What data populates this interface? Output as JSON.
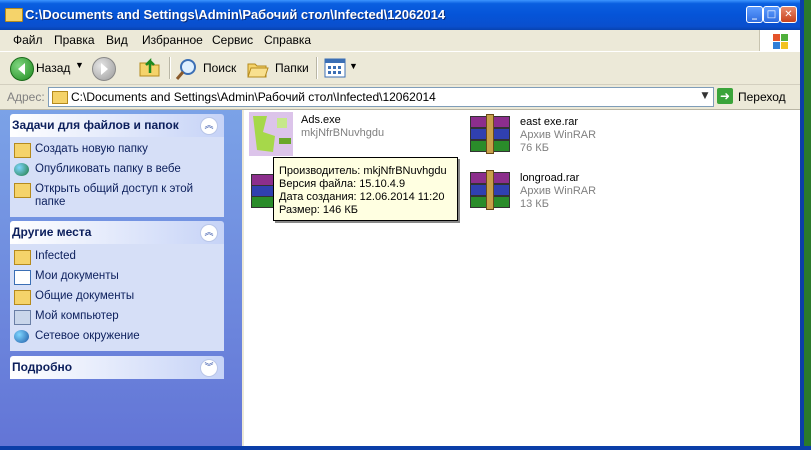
{
  "window": {
    "title": "C:\\Documents and Settings\\Admin\\Рабочий стол\\Infected\\12062014",
    "minimize_label": "_",
    "maximize_label": "□",
    "close_label": "✕"
  },
  "menu": [
    "Файл",
    "Правка",
    "Вид",
    "Избранное",
    "Сервис",
    "Справка"
  ],
  "toolbar": {
    "back_label": "Назад",
    "search_label": "Поиск",
    "folders_label": "Папки"
  },
  "address": {
    "label": "Адрес:",
    "value": "C:\\Documents and Settings\\Admin\\Рабочий стол\\Infected\\12062014",
    "go_label": "Переход"
  },
  "taskpane": {
    "file_tasks": {
      "title": "Задачи для файлов и папок",
      "items": [
        "Создать новую папку",
        "Опубликовать папку в вебе",
        "Открыть общий доступ к этой",
        "папке"
      ]
    },
    "other_places": {
      "title": "Другие места",
      "items": [
        "Infected",
        "Мои документы",
        "Общие документы",
        "Мой компьютер",
        "Сетевое окружение"
      ]
    },
    "details": {
      "title": "Подробно"
    }
  },
  "files": [
    {
      "name": "Ads.exe",
      "sub": "mkjNfrBNuvhgdu",
      "size": ""
    },
    {
      "name": "east exe.rar",
      "sub": "Архив WinRAR",
      "size": "76 КБ"
    },
    {
      "name": "longroad.rar",
      "sub": "Архив WinRAR",
      "size": "13 КБ"
    }
  ],
  "tooltip": {
    "line1": "Производитель: mkjNfrBNuvhgdu",
    "line2": "Версия файла: 15.10.4.9",
    "line3": "Дата создания: 12.06.2014 11:20",
    "line4": "Размер: 146 КБ"
  },
  "colors": {
    "titlebar": "#0554d8",
    "taskpane": "#7ba2e7",
    "tooltip_bg": "#ffffe1"
  }
}
